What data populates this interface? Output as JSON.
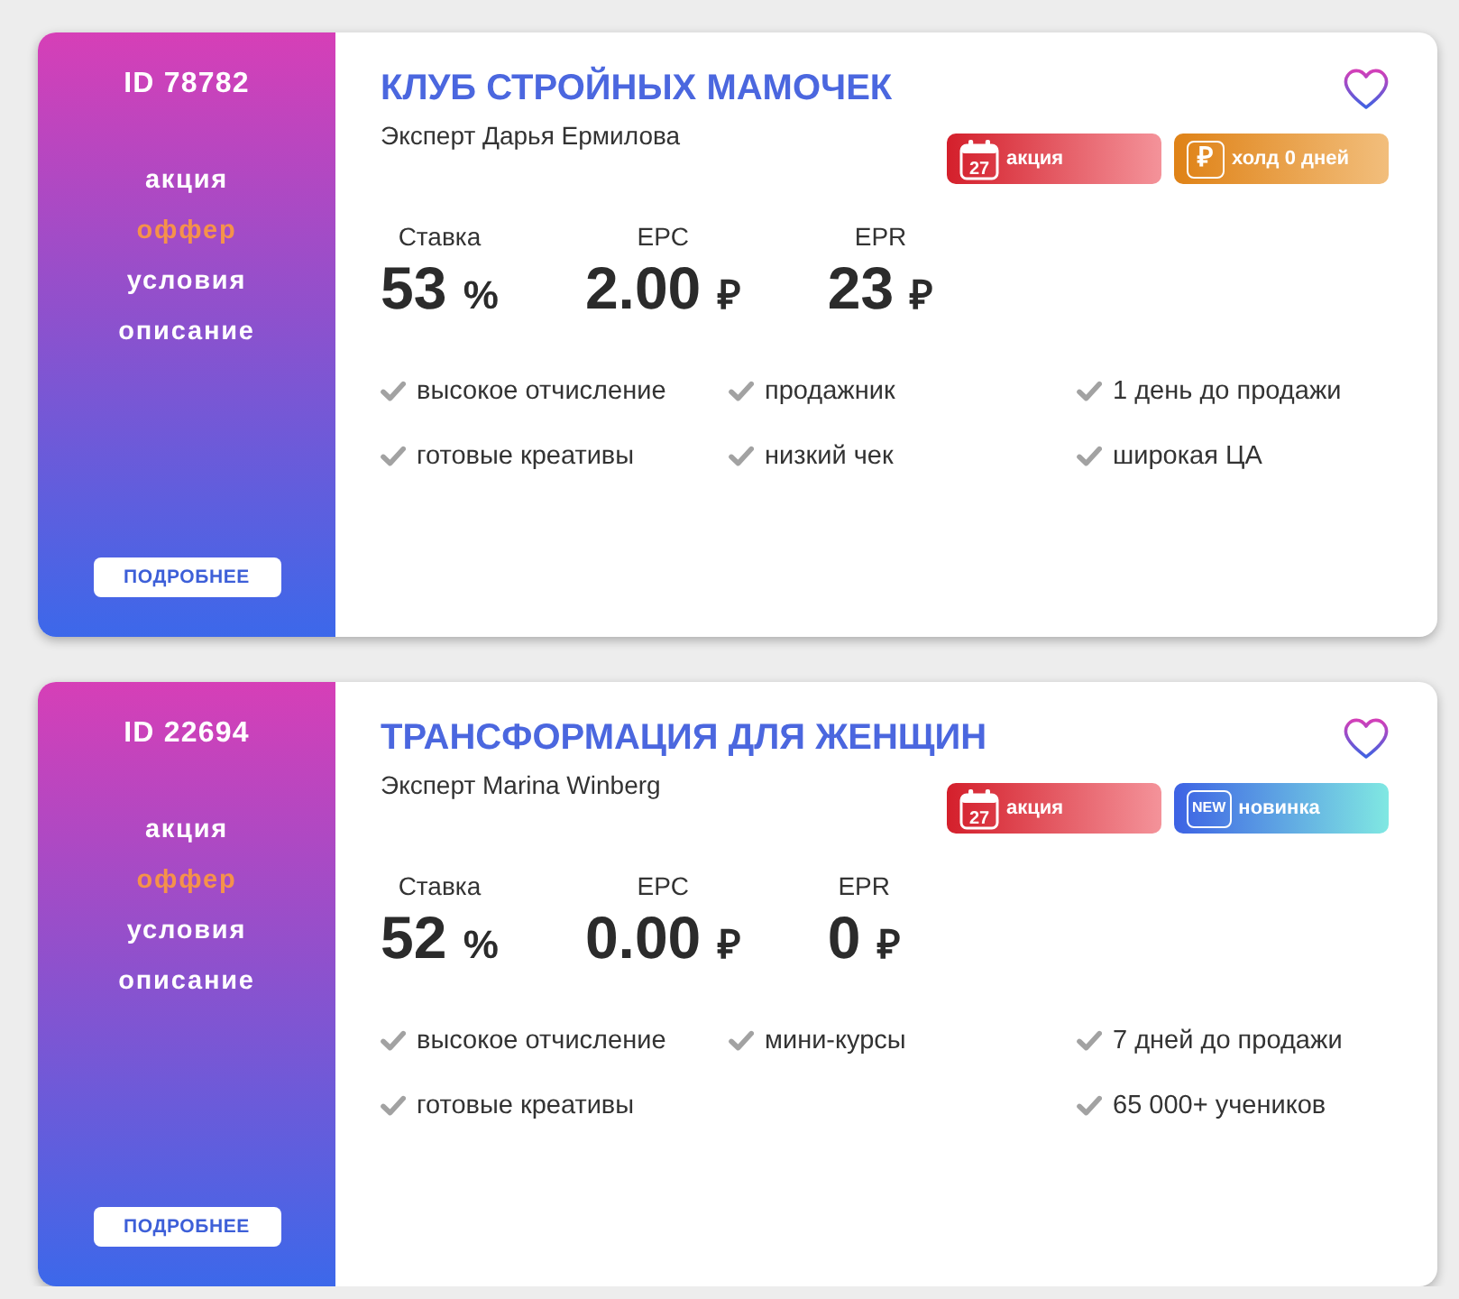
{
  "offers": [
    {
      "id_label": "ID 78782",
      "nav": [
        {
          "label": "акция",
          "selected": false
        },
        {
          "label": "оффер",
          "selected": true
        },
        {
          "label": "условия",
          "selected": false
        },
        {
          "label": "описание",
          "selected": false
        }
      ],
      "details_button": "ПОДРОБНЕЕ",
      "title": "КЛУБ СТРОЙНЫХ МАМОЧЕК",
      "expert": "Эксперт Дарья Ермилова",
      "favorite": false,
      "badges": [
        {
          "kind": "promo",
          "icon_text": "27",
          "label": "акция"
        },
        {
          "kind": "hold",
          "icon_text": "₽",
          "label": "холд 0 дней"
        }
      ],
      "stats": [
        {
          "label": "Ставка",
          "value": "53",
          "unit": "%"
        },
        {
          "label": "EPC",
          "value": "2.00",
          "unit": "₽"
        },
        {
          "label": "EPR",
          "value": "23",
          "unit": "₽"
        }
      ],
      "feature_columns": [
        [
          "высокое отчисление",
          "готовые креативы"
        ],
        [
          "продажник",
          "низкий чек"
        ],
        [
          "1 день до продажи",
          "широкая ЦА"
        ]
      ]
    },
    {
      "id_label": "ID 22694",
      "nav": [
        {
          "label": "акция",
          "selected": false
        },
        {
          "label": "оффер",
          "selected": true
        },
        {
          "label": "условия",
          "selected": false
        },
        {
          "label": "описание",
          "selected": false
        }
      ],
      "details_button": "ПОДРОБНЕЕ",
      "title": "ТРАНСФОРМАЦИЯ ДЛЯ ЖЕНЩИН",
      "expert": "Эксперт Marina Winberg",
      "favorite": false,
      "badges": [
        {
          "kind": "promo",
          "icon_text": "27",
          "label": "акция"
        },
        {
          "kind": "new",
          "icon_text": "NEW",
          "label": "новинка"
        }
      ],
      "stats": [
        {
          "label": "Ставка",
          "value": "52",
          "unit": "%"
        },
        {
          "label": "EPC",
          "value": "0.00",
          "unit": "₽"
        },
        {
          "label": "EPR",
          "value": "0",
          "unit": "₽"
        }
      ],
      "feature_columns": [
        [
          "высокое отчисление",
          "готовые креативы"
        ],
        [
          "мини-курсы"
        ],
        [
          "7 дней до продажи",
          "65 000+ учеников"
        ]
      ]
    }
  ]
}
